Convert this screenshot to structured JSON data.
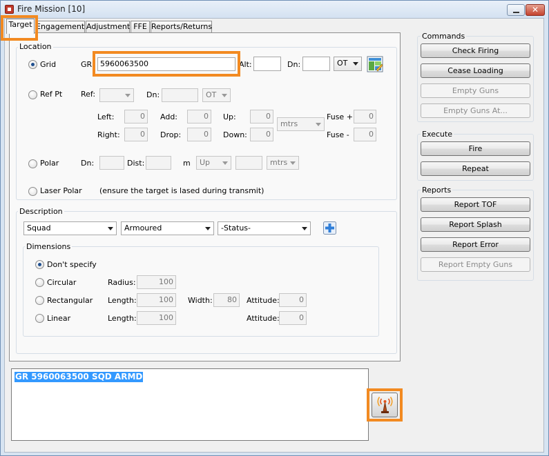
{
  "window": {
    "title": "Fire Mission [10]",
    "close_glyph": "✕"
  },
  "tabs": [
    {
      "label": "Target",
      "active": true
    },
    {
      "label": "Engagement"
    },
    {
      "label": "Adjustment"
    },
    {
      "label": "FFE"
    },
    {
      "label": "Reports/Returns"
    }
  ],
  "location": {
    "legend": "Location",
    "grid": {
      "label": "Grid",
      "gr_label": "GR:",
      "gr_value": "5960063500",
      "alt_label": "Alt:",
      "alt_value": "",
      "dn_label": "Dn:",
      "dn_value": "",
      "ot_value": "OT",
      "selected": true
    },
    "refpt": {
      "label": "Ref Pt",
      "ref_label": "Ref:",
      "ref_value": "",
      "dn_label": "Dn:",
      "dn_value": "",
      "ot_value": "OT",
      "left_label": "Left:",
      "left_value": "0",
      "add_label": "Add:",
      "add_value": "0",
      "up_label": "Up:",
      "up_value": "0",
      "right_label": "Right:",
      "right_value": "0",
      "drop_label": "Drop:",
      "drop_value": "0",
      "down_label": "Down:",
      "down_value": "0",
      "units_value": "mtrs",
      "fuse_plus_label": "Fuse +",
      "fuse_plus_value": "0",
      "fuse_minus_label": "Fuse -",
      "fuse_minus_value": "0"
    },
    "polar": {
      "label": "Polar",
      "dn_label": "Dn:",
      "dn_value": "",
      "dist_label": "Dist:",
      "dist_value": "",
      "m_label": "m",
      "updown_value": "Up",
      "amount_value": "",
      "units_value": "mtrs"
    },
    "laser_polar": {
      "label": "Laser Polar",
      "note": "(ensure the target is lased during transmit)"
    }
  },
  "description": {
    "legend": "Description",
    "size_value": "Squad",
    "type_value": "Armoured",
    "status_value": "-Status-",
    "dimensions": {
      "legend": "Dimensions",
      "dont_specify": "Don't specify",
      "circular": {
        "label": "Circular",
        "radius_label": "Radius:",
        "radius_value": "100"
      },
      "rectangular": {
        "label": "Rectangular",
        "length_label": "Length:",
        "length_value": "100",
        "width_label": "Width:",
        "width_value": "80",
        "attitude_label": "Attitude:",
        "attitude_value": "0"
      },
      "linear": {
        "label": "Linear",
        "length_label": "Length:",
        "length_value": "100",
        "attitude_label": "Attitude:",
        "attitude_value": "0"
      }
    }
  },
  "commands": {
    "legend": "Commands",
    "check_firing": "Check Firing",
    "cease_loading": "Cease Loading",
    "empty_guns": "Empty Guns",
    "empty_guns_at": "Empty Guns At..."
  },
  "execute": {
    "legend": "Execute",
    "fire": "Fire",
    "repeat": "Repeat"
  },
  "reports": {
    "legend": "Reports",
    "report_tof": "Report TOF",
    "report_splash": "Report Splash",
    "report_error": "Report Error",
    "report_empty_guns": "Report Empty Guns"
  },
  "message": {
    "text": "GR 5960063500 SQD ARMD"
  },
  "colors": {
    "highlight": "#f28a21",
    "selection": "#3399ff",
    "add_button": "#2f7ed8"
  },
  "icons": [
    "app-icon",
    "minimize-icon",
    "close-icon",
    "map-picker-icon",
    "add-icon",
    "transmit-antenna-icon"
  ]
}
